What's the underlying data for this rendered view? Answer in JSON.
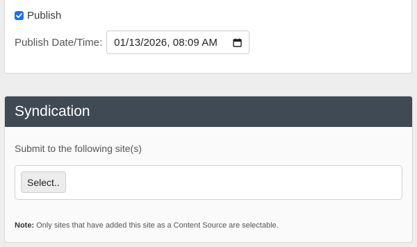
{
  "publish": {
    "checked": true,
    "label": "Publish",
    "datetime_label": "Publish Date/Time:",
    "datetime_value": "01/13/2026, 08:09  AM"
  },
  "syndication": {
    "title": "Syndication",
    "submit_label": "Submit to the following site(s)",
    "select_button_label": "Select..",
    "note_prefix": "Note:",
    "note_text": "Only sites that have added this site as a Content Source are selectable."
  },
  "colors": {
    "header_bg": "#3f4a55",
    "checkbox_accent": "#1a73e8",
    "page_bg": "#eeeeee"
  },
  "icons": {
    "checkbox": "check-icon",
    "datetime": "calendar-icon"
  }
}
